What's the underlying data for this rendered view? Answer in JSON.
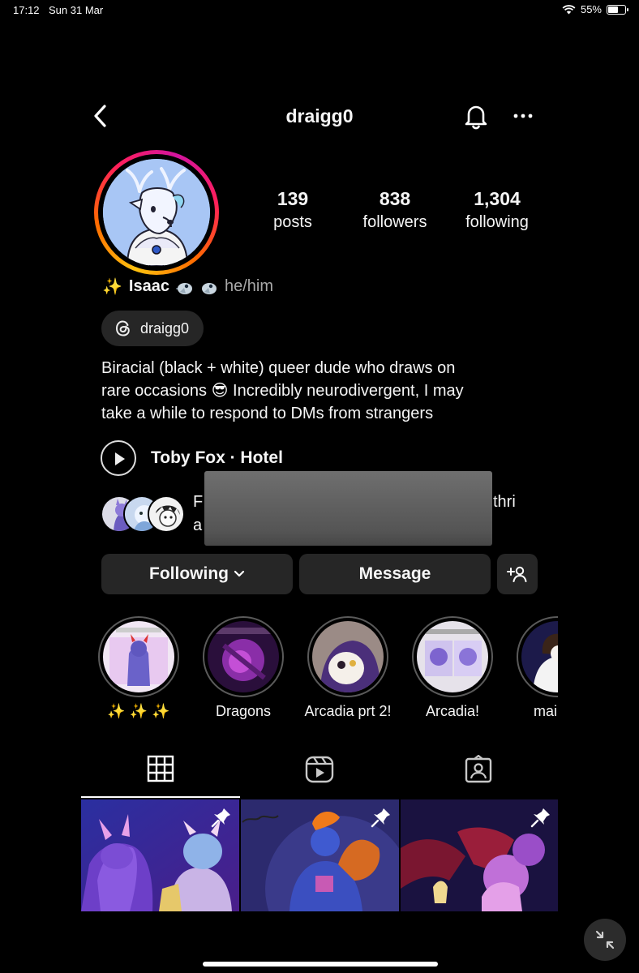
{
  "status_bar": {
    "time": "17:12",
    "date": "Sun 31 Mar",
    "battery": "55%",
    "battery_level": 0.55
  },
  "header": {
    "username": "draigg0",
    "back_icon": "chevron-left-icon",
    "bell_icon": "bell-icon",
    "more_icon": "more-horizontal-icon"
  },
  "stats": [
    {
      "value": "139",
      "label": "posts"
    },
    {
      "value": "838",
      "label": "followers"
    },
    {
      "value": "1,304",
      "label": "following"
    }
  ],
  "profile": {
    "sparkle": "✨",
    "name": "Isaac",
    "pronouns": "he/him",
    "threads_handle": "draigg0",
    "bio_lines": [
      "Biracial (black + white) queer dude who draws on",
      "rare occasions 😎 Incredibly neurodivergent, I may",
      "take a while to respond to DMs from strangers"
    ]
  },
  "music": {
    "label": "Toby Fox · Hotel"
  },
  "followed_by": {
    "line1_start": "F",
    "line1_end": "thri",
    "line2_start": "a"
  },
  "actions": {
    "following_label": "Following",
    "message_label": "Message"
  },
  "highlights": [
    {
      "label": "✨ ✨ ✨"
    },
    {
      "label": "Dragons"
    },
    {
      "label": "Arcadia prt 2!"
    },
    {
      "label": "Arcadia!"
    },
    {
      "label": "main pi"
    }
  ],
  "tabs": [
    {
      "icon": "grid-icon",
      "selected": true
    },
    {
      "icon": "reels-icon",
      "selected": false
    },
    {
      "icon": "tagged-icon",
      "selected": false
    }
  ],
  "colors": {
    "background": "#000000",
    "button": "#262626",
    "secondary_text": "#a8a8a8"
  }
}
